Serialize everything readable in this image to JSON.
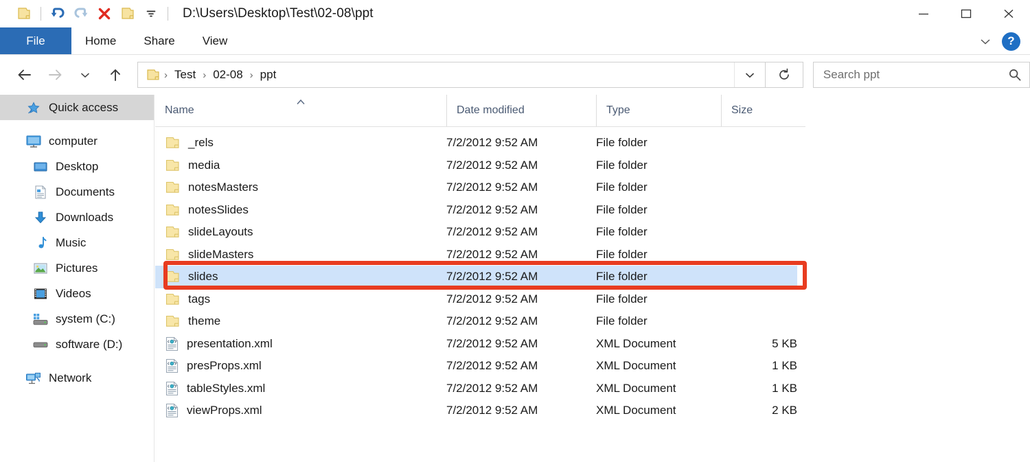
{
  "window": {
    "title_path": "D:\\Users\\Desktop\\Test\\02-08\\ppt",
    "minimize_label": "–",
    "maximize_label": "□",
    "close_label": "✕",
    "help_label": "?",
    "accent_blue": "#2b6cb5",
    "selection_blue": "#cfe3fa",
    "annotation_red": "#e83c20"
  },
  "quick_access_toolbar": {
    "items": [
      {
        "name": "folder-icon",
        "label": "Folder"
      },
      {
        "name": "undo-icon",
        "label": "Undo"
      },
      {
        "name": "redo-icon",
        "label": "Redo"
      },
      {
        "name": "delete-icon",
        "label": "Delete"
      },
      {
        "name": "new-folder-icon",
        "label": "New folder"
      },
      {
        "name": "chevron-down-icon",
        "label": "Customize Quick Access Toolbar"
      }
    ]
  },
  "ribbon": {
    "tabs": [
      {
        "label": "File",
        "active": true
      },
      {
        "label": "Home",
        "active": false
      },
      {
        "label": "Share",
        "active": false
      },
      {
        "label": "View",
        "active": false
      }
    ]
  },
  "address_bar": {
    "back_label": "Back",
    "forward_label": "Forward",
    "recent_label": "Recent locations",
    "up_label": "Up",
    "crumbs": [
      "Test",
      "02-08",
      "ppt"
    ],
    "separator": "›",
    "refresh_label": "Refresh"
  },
  "search": {
    "placeholder": "Search ppt",
    "value": ""
  },
  "sidebar": {
    "items": [
      {
        "label": "Quick access",
        "icon": "pin-star-icon",
        "level": 0,
        "selected": true
      },
      {
        "label": "computer",
        "icon": "computer-icon",
        "level": 0,
        "selected": false
      },
      {
        "label": "Desktop",
        "icon": "desktop-icon",
        "level": 1,
        "selected": false
      },
      {
        "label": "Documents",
        "icon": "documents-icon",
        "level": 1,
        "selected": false
      },
      {
        "label": "Downloads",
        "icon": "downloads-icon",
        "level": 1,
        "selected": false
      },
      {
        "label": "Music",
        "icon": "music-icon",
        "level": 1,
        "selected": false
      },
      {
        "label": "Pictures",
        "icon": "pictures-icon",
        "level": 1,
        "selected": false
      },
      {
        "label": "Videos",
        "icon": "videos-icon",
        "level": 1,
        "selected": false
      },
      {
        "label": "system (C:)",
        "icon": "system-drive-icon",
        "level": 1,
        "selected": false
      },
      {
        "label": "software (D:)",
        "icon": "drive-icon",
        "level": 1,
        "selected": false
      },
      {
        "label": "Network",
        "icon": "network-icon",
        "level": 0,
        "selected": false
      }
    ]
  },
  "file_list": {
    "columns": [
      {
        "label": "Name",
        "sorted": "asc"
      },
      {
        "label": "Date modified",
        "sorted": null
      },
      {
        "label": "Type",
        "sorted": null
      },
      {
        "label": "Size",
        "sorted": null
      }
    ],
    "rows": [
      {
        "name": "_rels",
        "date": "7/2/2012 9:52 AM",
        "type": "File folder",
        "size": "",
        "icon": "folder-icon",
        "selected": false
      },
      {
        "name": "media",
        "date": "7/2/2012 9:52 AM",
        "type": "File folder",
        "size": "",
        "icon": "folder-icon",
        "selected": false
      },
      {
        "name": "notesMasters",
        "date": "7/2/2012 9:52 AM",
        "type": "File folder",
        "size": "",
        "icon": "folder-icon",
        "selected": false
      },
      {
        "name": "notesSlides",
        "date": "7/2/2012 9:52 AM",
        "type": "File folder",
        "size": "",
        "icon": "folder-icon",
        "selected": false
      },
      {
        "name": "slideLayouts",
        "date": "7/2/2012 9:52 AM",
        "type": "File folder",
        "size": "",
        "icon": "folder-icon",
        "selected": false
      },
      {
        "name": "slideMasters",
        "date": "7/2/2012 9:52 AM",
        "type": "File folder",
        "size": "",
        "icon": "folder-icon",
        "selected": false
      },
      {
        "name": "slides",
        "date": "7/2/2012 9:52 AM",
        "type": "File folder",
        "size": "",
        "icon": "folder-icon",
        "selected": true
      },
      {
        "name": "tags",
        "date": "7/2/2012 9:52 AM",
        "type": "File folder",
        "size": "",
        "icon": "folder-icon",
        "selected": false
      },
      {
        "name": "theme",
        "date": "7/2/2012 9:52 AM",
        "type": "File folder",
        "size": "",
        "icon": "folder-icon",
        "selected": false
      },
      {
        "name": "presentation.xml",
        "date": "7/2/2012 9:52 AM",
        "type": "XML Document",
        "size": "5 KB",
        "icon": "xml-document-icon",
        "selected": false
      },
      {
        "name": "presProps.xml",
        "date": "7/2/2012 9:52 AM",
        "type": "XML Document",
        "size": "1 KB",
        "icon": "xml-document-icon",
        "selected": false
      },
      {
        "name": "tableStyles.xml",
        "date": "7/2/2012 9:52 AM",
        "type": "XML Document",
        "size": "1 KB",
        "icon": "xml-document-icon",
        "selected": false
      },
      {
        "name": "viewProps.xml",
        "date": "7/2/2012 9:52 AM",
        "type": "XML Document",
        "size": "2 KB",
        "icon": "xml-document-icon",
        "selected": false
      }
    ]
  },
  "annotation": {
    "target_row": "slides",
    "shape": "rectangle"
  }
}
